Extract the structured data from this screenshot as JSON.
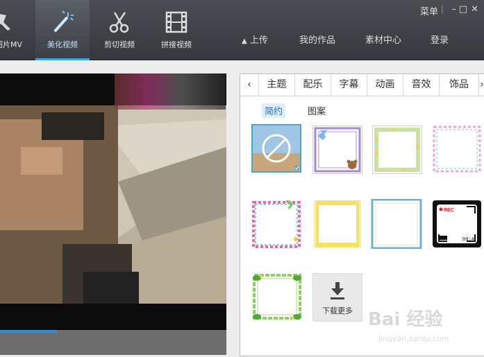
{
  "toolbar": {
    "tools": [
      {
        "label": "图片MV",
        "icon": "photo-mv-icon"
      },
      {
        "label": "美化视频",
        "icon": "magic-wand-icon"
      },
      {
        "label": "剪切视频",
        "icon": "scissors-icon"
      },
      {
        "label": "拼接视频",
        "icon": "film-strip-icon"
      }
    ],
    "nav": {
      "upload": "上传",
      "my_works": "我的作品",
      "materials": "素材中心",
      "login": "登录"
    },
    "window": {
      "menu": "菜单",
      "minimize": "–",
      "maximize": "□",
      "close": "✕"
    }
  },
  "preview": {
    "progress": 0.25
  },
  "panel": {
    "tabs": [
      "主题",
      "配乐",
      "字幕",
      "动画",
      "音效",
      "饰品"
    ],
    "subtabs": [
      "简约",
      "图案"
    ],
    "active_subtab": "简约",
    "frames": [
      {
        "name": "none",
        "selected": true
      },
      {
        "name": "ribbon-bear"
      },
      {
        "name": "green-dots"
      },
      {
        "name": "pastel-dots"
      },
      {
        "name": "colorful-stripes"
      },
      {
        "name": "yellow-scallop"
      },
      {
        "name": "blue-simple"
      },
      {
        "name": "rec-camera"
      },
      {
        "name": "green-leaves"
      }
    ],
    "rec_text": "REC",
    "rec_time": "00:4",
    "download": "下载更多"
  },
  "watermark": {
    "text": "Bai 经验",
    "sub": "jingyan.baidu.com"
  }
}
